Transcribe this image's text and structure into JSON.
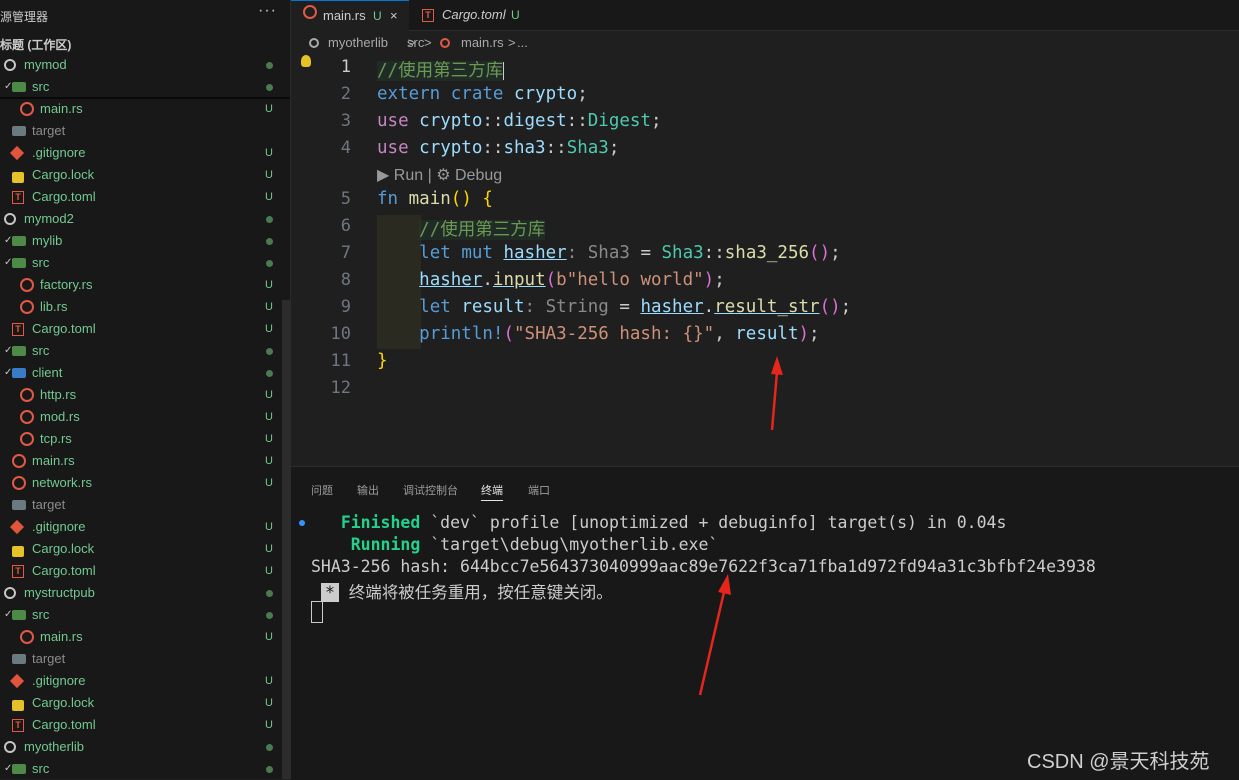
{
  "sidebar": {
    "title": "源管理器",
    "more": "···",
    "workspace": "标题 (工作区)",
    "items": [
      {
        "label": "mymod",
        "status": "dot",
        "icon": "ring-icon"
      },
      {
        "label": "src",
        "status": "dot",
        "icon": "folder-icon"
      },
      {
        "label": "main.rs",
        "status": "U",
        "icon": "rust-icon"
      },
      {
        "label": "target",
        "status": "",
        "icon": "folder-grey-icon"
      },
      {
        "label": ".gitignore",
        "status": "U",
        "icon": "git-icon"
      },
      {
        "label": "Cargo.lock",
        "status": "U",
        "icon": "lock-icon"
      },
      {
        "label": "Cargo.toml",
        "status": "U",
        "icon": "toml-icon"
      },
      {
        "label": "mymod2",
        "status": "dot",
        "icon": "ring-icon"
      },
      {
        "label": "mylib",
        "status": "dot",
        "icon": "folder-icon"
      },
      {
        "label": "src",
        "status": "dot",
        "icon": "folder-icon"
      },
      {
        "label": "factory.rs",
        "status": "U",
        "icon": "rust-icon"
      },
      {
        "label": "lib.rs",
        "status": "U",
        "icon": "rust-icon"
      },
      {
        "label": "Cargo.toml",
        "status": "U",
        "icon": "toml-icon"
      },
      {
        "label": "src",
        "status": "dot",
        "icon": "folder-icon"
      },
      {
        "label": "client",
        "status": "dot",
        "icon": "folder-blue-icon"
      },
      {
        "label": "http.rs",
        "status": "U",
        "icon": "rust-icon"
      },
      {
        "label": "mod.rs",
        "status": "U",
        "icon": "rust-icon"
      },
      {
        "label": "tcp.rs",
        "status": "U",
        "icon": "rust-icon"
      },
      {
        "label": "main.rs",
        "status": "U",
        "icon": "rust-icon"
      },
      {
        "label": "network.rs",
        "status": "U",
        "icon": "rust-icon"
      },
      {
        "label": "target",
        "status": "",
        "icon": "folder-grey-icon"
      },
      {
        "label": ".gitignore",
        "status": "U",
        "icon": "git-icon"
      },
      {
        "label": "Cargo.lock",
        "status": "U",
        "icon": "lock-icon"
      },
      {
        "label": "Cargo.toml",
        "status": "U",
        "icon": "toml-icon"
      },
      {
        "label": "mystructpub",
        "status": "dot",
        "icon": "ring-icon"
      },
      {
        "label": "src",
        "status": "dot",
        "icon": "folder-icon"
      },
      {
        "label": "main.rs",
        "status": "U",
        "icon": "rust-icon"
      },
      {
        "label": "target",
        "status": "",
        "icon": "folder-grey-icon"
      },
      {
        "label": ".gitignore",
        "status": "U",
        "icon": "git-icon"
      },
      {
        "label": "Cargo.lock",
        "status": "U",
        "icon": "lock-icon"
      },
      {
        "label": "Cargo.toml",
        "status": "U",
        "icon": "toml-icon"
      },
      {
        "label": "myotherlib",
        "status": "dot",
        "icon": "ring-icon"
      },
      {
        "label": "src",
        "status": "dot",
        "icon": "folder-icon"
      }
    ]
  },
  "tabs": [
    {
      "label": "main.rs",
      "status": "U",
      "close": "×"
    },
    {
      "label": "Cargo.toml",
      "status": "U"
    }
  ],
  "breadcrumb": [
    "myotherlib",
    ">",
    "src",
    ">",
    "main.rs",
    ">",
    "..."
  ],
  "editor": {
    "line_numbers": [
      "1",
      "2",
      "3",
      "4",
      "5",
      "6",
      "7",
      "8",
      "9",
      "10",
      "11",
      "12"
    ],
    "codelens": {
      "run": "Run",
      "sep": "|",
      "debug": "Debug"
    },
    "lines": {
      "l1": "//使用第三方库",
      "l2_kw": "extern",
      "l2_kw2": "crate",
      "l2_id": "crypto",
      "l2_end": ";",
      "l3_kw": "use",
      "l3_a": "crypto",
      "l3_b": "digest",
      "l3_c": "Digest",
      "l3_sep": "::",
      "l3_end": ";",
      "l4_kw": "use",
      "l4_a": "crypto",
      "l4_b": "sha3",
      "l4_c": "Sha3",
      "l4_sep": "::",
      "l4_end": ";",
      "l5_kw": "fn",
      "l5_fn": "main",
      "l5_paren": "()",
      "l5_brace": "{",
      "l6": "//使用第三方库",
      "l7_let": "let",
      "l7_mut": "mut",
      "l7_var": "hasher",
      "l7_hint": ": Sha3",
      "l7_eq": " = ",
      "l7_type": "Sha3",
      "l7_sep": "::",
      "l7_fn": "sha3_256",
      "l7_paren": "()",
      "l7_end": ";",
      "l8_var": "hasher",
      "l8_dot": ".",
      "l8_fn": "input",
      "l8_open": "(",
      "l8_str": "b\"hello world\"",
      "l8_close": ")",
      "l8_end": ";",
      "l9_let": "let",
      "l9_var": "result",
      "l9_hint": ": String",
      "l9_eq": " = ",
      "l9_obj": "hasher",
      "l9_dot": ".",
      "l9_fn": "result_str",
      "l9_paren": "()",
      "l9_end": ";",
      "l10_mac": "println!",
      "l10_open": "(",
      "l10_str": "\"SHA3-256 hash: {}\"",
      "l10_comma": ", ",
      "l10_var": "result",
      "l10_close": ")",
      "l10_end": ";",
      "l11": "}"
    }
  },
  "panel": {
    "tabs": [
      "问题",
      "输出",
      "调试控制台",
      "终端",
      "端口"
    ],
    "active_tab": "终端",
    "terminal": {
      "l1_word": "Finished",
      "l1_rest": " `dev` profile [unoptimized + debuginfo] target(s) in 0.04s",
      "l2_word": "Running",
      "l2_rest": " `target\\debug\\myotherlib.exe`",
      "l3": "SHA3-256 hash: 644bcc7e564373040999aac89e7622f3ca71fba1d972fd94a31c3bfbf24e3938",
      "l4_star": "*",
      "l4_text": " 终端将被任务重用，按任意键关闭。"
    }
  },
  "watermark": "CSDN @景天科技苑",
  "colors": {
    "accent": "#0078d4",
    "untracked": "#73c991",
    "arrow": "#e5261c"
  }
}
